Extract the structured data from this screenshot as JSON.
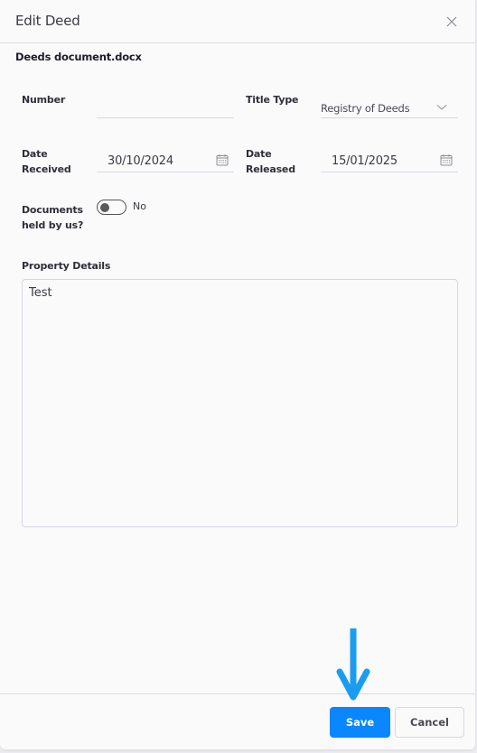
{
  "dialog": {
    "title": "Edit Deed",
    "document_name": "Deeds document.docx"
  },
  "form": {
    "number": {
      "label": "Number",
      "value": ""
    },
    "title_type": {
      "label": "Title Type",
      "value": "Registry of Deeds"
    },
    "date_received": {
      "label_line1": "Date",
      "label_line2": "Received",
      "value": "30/10/2024"
    },
    "date_released": {
      "label_line1": "Date",
      "label_line2": "Released",
      "value": "15/01/2025"
    },
    "documents_held": {
      "label_line1": "Documents",
      "label_line2": "held by us?",
      "toggle_state": "No"
    },
    "property_details": {
      "label": "Property Details",
      "value": "Test"
    }
  },
  "footer": {
    "save_label": "Save",
    "cancel_label": "Cancel"
  },
  "colors": {
    "primary": "#0a86ff",
    "annotation_arrow": "#1a9cf0"
  }
}
